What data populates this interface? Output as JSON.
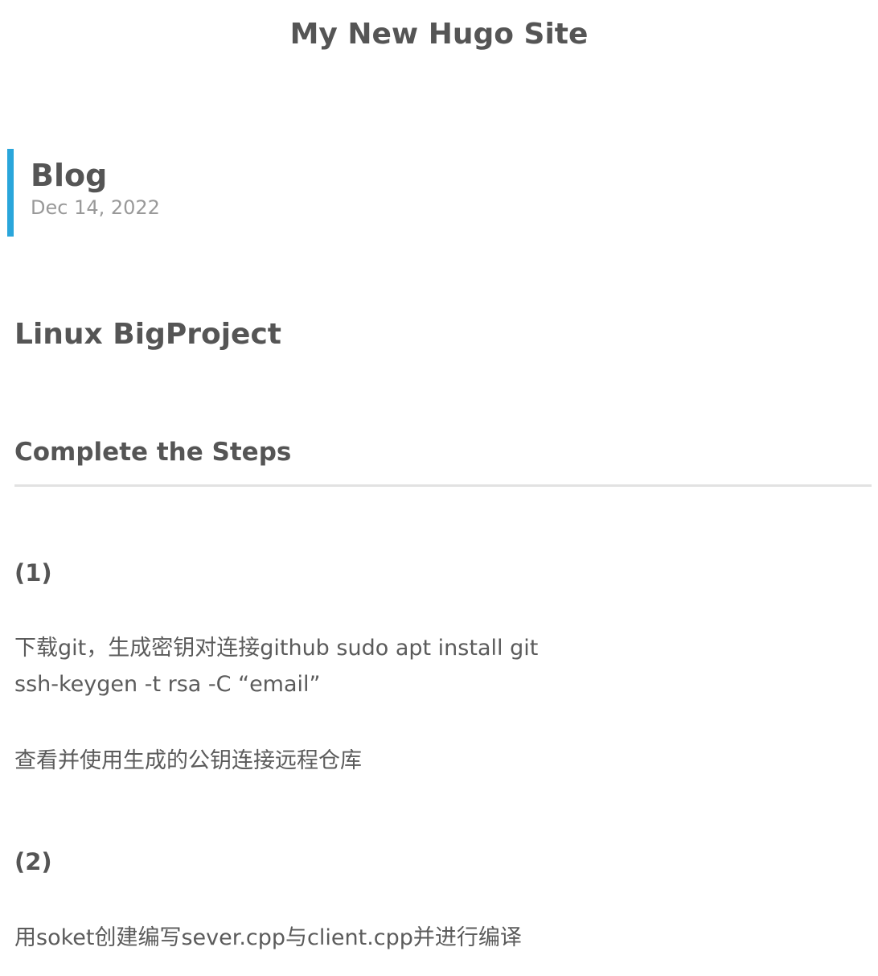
{
  "site": {
    "title": "My New Hugo Site"
  },
  "post": {
    "title": "Blog",
    "date": "Dec 14, 2022",
    "accent_color": "#2aa6db"
  },
  "content": {
    "h1": "Linux BigProject",
    "h2": "Complete the Steps",
    "sections": [
      {
        "heading": "(1)",
        "paragraphs": [
          [
            "下载git，生成密钥对连接github sudo apt install git",
            "ssh-keygen -t rsa -C “email”"
          ],
          [
            "查看并使用生成的公钥连接远程仓库"
          ]
        ]
      },
      {
        "heading": "(2)",
        "paragraphs": [
          [
            "用soket创建编写sever.cpp与client.cpp并进行编译"
          ]
        ]
      }
    ]
  }
}
